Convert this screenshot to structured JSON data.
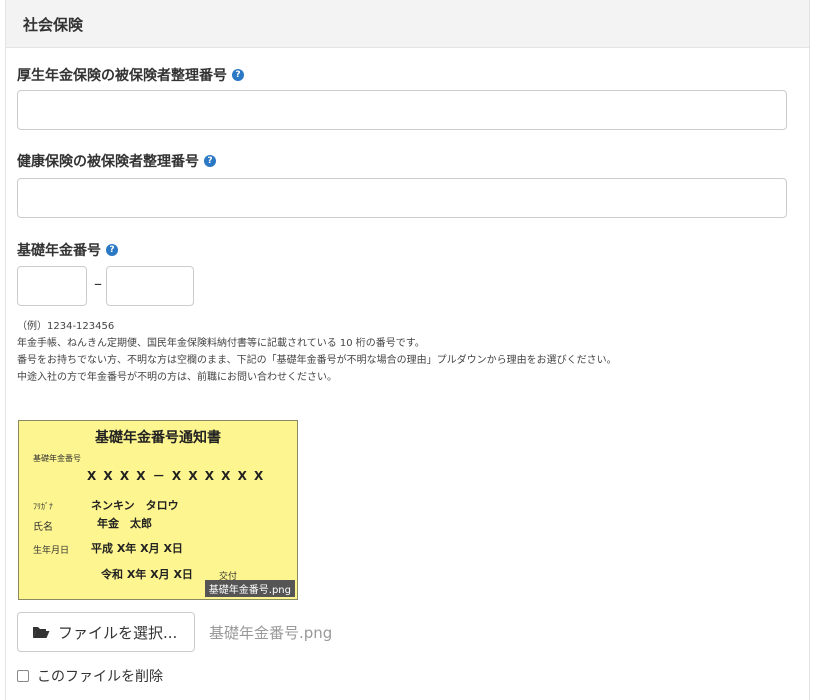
{
  "section": {
    "title": "社会保険"
  },
  "fields": {
    "kosei": {
      "label": "厚生年金保険の被保険者整理番号",
      "value": ""
    },
    "kenko": {
      "label": "健康保険の被保険者整理番号",
      "value": ""
    },
    "kiso": {
      "label": "基礎年金番号",
      "value_part1": "",
      "value_part2": "",
      "separator": "–",
      "notes": [
        "（例）1234-123456",
        "年金手帳、ねんきん定期便、国民年金保険料納付書等に記載されている 10 桁の番号です。",
        "番号をお持ちでない方、不明な方は空欄のまま、下記の「基礎年金番号が不明な場合の理由」プルダウンから理由をお選びください。",
        "中途入社の方で年金番号が不明の方は、前職にお問い合わせください。"
      ]
    }
  },
  "help_icon_glyph": "?",
  "card": {
    "title": "基礎年金番号通知書",
    "number_label": "基礎年金番号",
    "number": "X X X X － X X X X X X",
    "furigana_label": "ﾌﾘｶﾞﾅ",
    "furigana": "ネンキン　タロウ",
    "name_label": "氏名",
    "name": "年金　太郎",
    "birth_label": "生年月日",
    "birth": "平成 X年 X月 X日",
    "issued": "令和 X年 X月 X日",
    "issued_suffix": "交付",
    "filename_overlay": "基礎年金番号.png"
  },
  "file": {
    "button_label": "ファイルを選択...",
    "selected_name": "基礎年金番号.png",
    "delete_label": "このファイルを削除"
  },
  "colors": {
    "help_icon": "#2b78c5",
    "card_bg": "#fdf58f"
  }
}
